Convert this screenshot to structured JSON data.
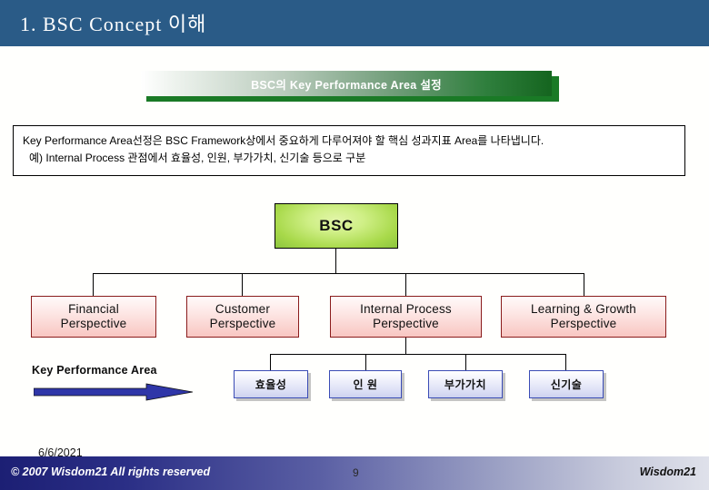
{
  "header": {
    "title": "1. BSC Concept 이해",
    "bg_color": "#2a5b87"
  },
  "banner": {
    "text": "BSC의  Key Performance Area 설정",
    "gradient_from": "#ffffff",
    "gradient_to": "#15651f",
    "shadow_color": "#1a7a26"
  },
  "description": {
    "line1": "Key Performance Area선정은 BSC Framework상에서 중요하게 다루어져야 할 핵심 성과지표 Area를 나타냅니다.",
    "line2": "예) Internal Process 관점에서 효율성, 인원, 부가가치, 신기술 등으로 구분"
  },
  "diagram": {
    "root": {
      "label": "BSC",
      "fill_color": "#a8d94a"
    },
    "perspectives": [
      {
        "label": "Financial\nPerspective",
        "line1": "Financial",
        "line2": "Perspective"
      },
      {
        "label": "Customer\nPerspective",
        "line1": "Customer",
        "line2": "Perspective"
      },
      {
        "label": "Internal Process\nPerspective",
        "line1": "Internal Process",
        "line2": "Perspective"
      },
      {
        "label": "Learning & Growth\nPerspective",
        "line1": "Learning & Growth",
        "line2": "Perspective"
      }
    ],
    "perspective_fill_color": "#f8c6c2",
    "perspective_border_color": "#8a1c1c",
    "kpa_label": "Key Performance Area",
    "kpa_arrow_color": "#2f36a8",
    "kpa_items": [
      {
        "label": "효율성"
      },
      {
        "label": "인 원"
      },
      {
        "label": "부가가치"
      },
      {
        "label": "신기술"
      }
    ],
    "kpa_fill_color": "#dcdff5",
    "kpa_border_color": "#3a4bb5"
  },
  "footer": {
    "date": "6/6/2021",
    "copyright": "© 2007  Wisdom21 All rights reserved",
    "page_number": "9",
    "brand": "Wisdom21"
  }
}
